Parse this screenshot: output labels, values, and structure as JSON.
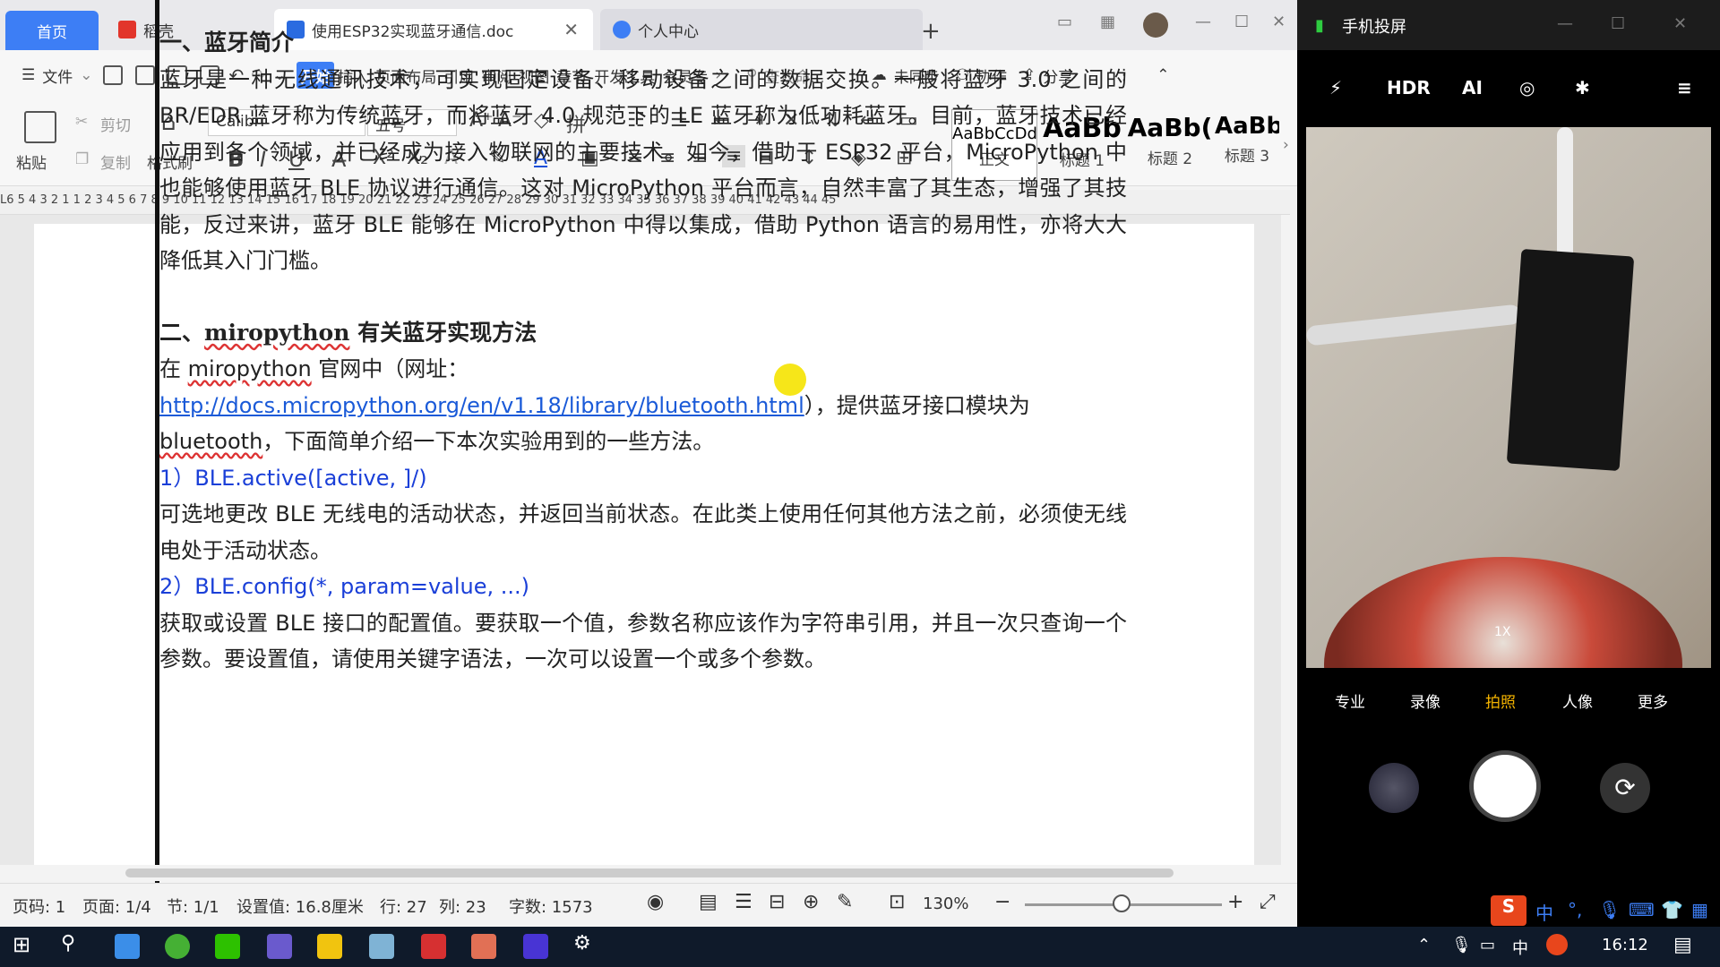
{
  "tabs": {
    "home": "首页",
    "daoke": "稻壳",
    "doc": "使用ESP32实现蓝牙通信.doc",
    "user": "个人中心"
  },
  "menu": [
    "文件",
    "开始",
    "插入",
    "页面布局",
    "引用",
    "审阅",
    "视图",
    "章节",
    "开发工具",
    "会员专"
  ],
  "menu_active": "开始",
  "search_placeholder": "查找命...",
  "sync": "未同步",
  "collab": "协作",
  "share": "分享",
  "clipboard": {
    "paste": "粘贴",
    "cut": "剪切",
    "copy": "复制",
    "format": "格式刷"
  },
  "font": {
    "name": "Calibri",
    "size": "五号"
  },
  "styles": [
    {
      "sample": "AaBbCcDd",
      "label": "正文"
    },
    {
      "sample": "AaBb",
      "label": "标题 1"
    },
    {
      "sample": "AaBb(",
      "label": "标题 2"
    },
    {
      "sample": "AaBb",
      "label": "标题 3"
    }
  ],
  "ruler": "L6  5  4  3  2  1        1  2  3  4  5  6  7  8  9 10 11 12 13 14 15 16 17 18 19 20 21 22 23 24 25 26 27 28 29 30 31 32 33 34 35 36 37 38 39 40 41 42 43 44 45",
  "doc": {
    "h1": "一、蓝牙简介",
    "p1": "蓝牙是一种无线通讯技术，可实现固定设备、移动设备之间的数据交换。一般将蓝牙 3.0 之间的 BR/EDR 蓝牙称为传统蓝牙，而将蓝牙 4.0 规范下的 LE 蓝牙称为低功耗蓝牙。目前，蓝牙技术已经应用到各个领域，并已经成为接入物联网的主要技术。如今，借助于 ESP32 平台，MicroPython 中也能够使用蓝牙 BLE 协议进行通信。这对 MicroPython 平台而言，自然丰富了其生态，增强了其技能，反过来讲，蓝牙 BLE 能够在 MicroPython 中得以集成，借助 Python 语言的易用性，亦将大大降低其入门门槛。",
    "h2_prefix": "二、",
    "h2_word": "miropython",
    "h2_suffix": " 有关蓝牙实现方法",
    "p2_a": "在 ",
    "p2_word": "miropython",
    "p2_b": " 官网中（网址：",
    "p2_link": "http://docs.micropython.org/en/v1.18/library/bluetooth.html",
    "p2_c": "），提供蓝牙接口模块为 ",
    "p2_word2": "bluetooth",
    "p2_d": "，下面简单介绍一下本次实验用到的一些方法。",
    "m1": "1）BLE.active([active, ]/)",
    "m1_desc": "可选地更改 BLE 无线电的活动状态，并返回当前状态。在此类上使用任何其他方法之前，必须使无线电处于活动状态。",
    "m2": "2）BLE.config(*, param=value, ...)",
    "m2_desc": "获取或设置 BLE 接口的配置值。要获取一个值，参数名称应该作为字符串引用，并且一次只查询一个参数。要设置值，请使用关键字语法，一次可以设置一个或多个参数。"
  },
  "status": {
    "pageno": "页码: 1",
    "page": "页面: 1/4",
    "section": "节: 1/1",
    "setting": "设置值: 16.8厘米",
    "row": "行: 27",
    "col": "列: 23",
    "words": "字数: 1573",
    "zoom": "130%"
  },
  "phone": {
    "title": "手机投屏",
    "top": [
      "HDR",
      "AI"
    ],
    "zoom": "1X",
    "modes": [
      "专业",
      "录像",
      "拍照",
      "人像",
      "更多"
    ],
    "mode_selected": "拍照"
  },
  "ime": {
    "mode": "中"
  },
  "taskbar": {
    "ime": "中",
    "time": "16:12"
  }
}
